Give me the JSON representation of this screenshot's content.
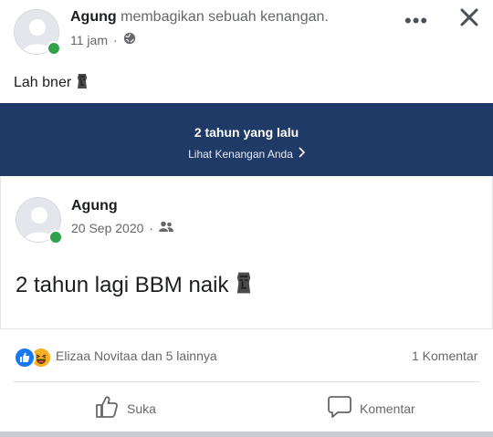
{
  "post": {
    "author": "Agung",
    "action": "membagikan sebuah kenangan.",
    "time": "11 jam",
    "separator": "·",
    "privacy_icon": "globe-icon",
    "text": "Lah bner",
    "emoji": "moai"
  },
  "memory": {
    "title": "2 tahun yang lalu",
    "link": "Lihat Kenangan Anda"
  },
  "shared_post": {
    "author": "Agung",
    "date": "20 Sep 2020",
    "separator": "·",
    "privacy_icon": "friends-icon",
    "text": "2 tahun lagi BBM naik",
    "emoji": "moai"
  },
  "reactions": {
    "icons": [
      "like-icon",
      "haha-icon"
    ],
    "names": "Elizaa Novitaa dan 5 lainnya",
    "comments": "1 Komentar"
  },
  "actions": {
    "like_label": "Suka",
    "comment_label": "Komentar"
  },
  "colors": {
    "banner": "#1f3a67",
    "online": "#31a24c",
    "like_blue": "#1877f2",
    "haha_yellow": "#f7b125"
  }
}
